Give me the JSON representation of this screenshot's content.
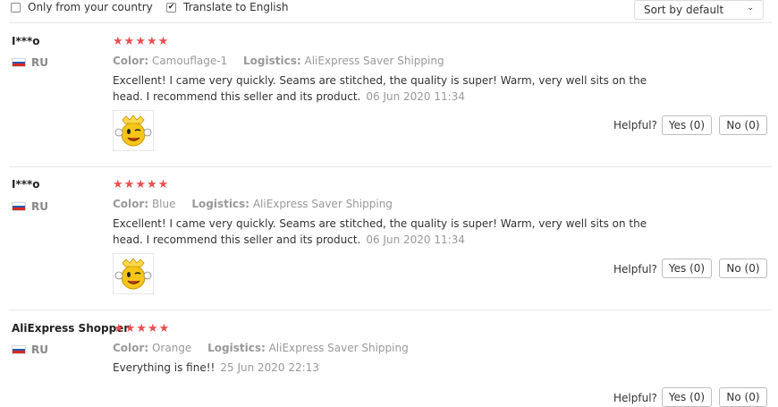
{
  "filters": {
    "only_country_label": "Only from your country",
    "only_country_checked": false,
    "translate_label": "Translate to English",
    "translate_checked": true,
    "sort_value": "Sort by default"
  },
  "labels": {
    "color_key": "Color:",
    "logistics_key": "Logistics:",
    "helpful": "Helpful?",
    "yes": "Yes (0)",
    "no": "No (0)"
  },
  "reviews": [
    {
      "user": "I***o",
      "country": "RU",
      "rating": 5,
      "color": "Camouflage-1",
      "logistics": "AliExpress Saver Shipping",
      "text": "Excellent! I came very quickly. Seams are stitched, the quality is super! Warm, very well sits on the head. I recommend this seller and its product.",
      "date": "06 Jun 2020 11:34",
      "has_photo": true
    },
    {
      "user": "I***o",
      "country": "RU",
      "rating": 5,
      "color": "Blue",
      "logistics": "AliExpress Saver Shipping",
      "text": "Excellent! I came very quickly. Seams are stitched, the quality is super! Warm, very well sits on the head. I recommend this seller and its product.",
      "date": "06 Jun 2020 11:34",
      "has_photo": true
    },
    {
      "user": "AliExpress Shopper",
      "country": "RU",
      "rating": 5,
      "color": "Orange",
      "logistics": "AliExpress Saver Shipping",
      "text": "Everything is fine!!",
      "date": "25 Jun 2020 22:13",
      "has_photo": false
    }
  ],
  "colors": {
    "star": "#e94f4f",
    "muted_text": "#999999",
    "body_text": "#333333",
    "divider": "#e8e8e8"
  },
  "icons": {
    "photo_thumb": "smiley-thumbs-up-emoji-icon",
    "flag": "russia-flag-icon",
    "star": "star-icon"
  }
}
